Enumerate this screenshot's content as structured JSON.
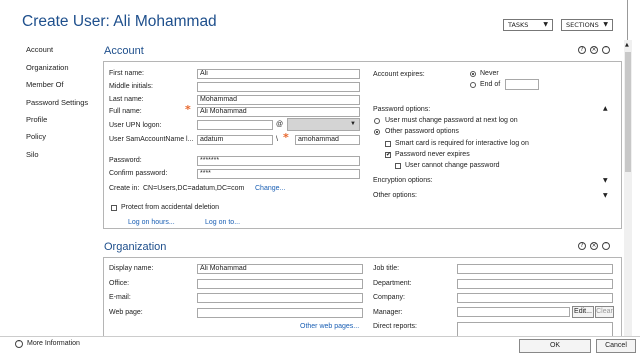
{
  "window": {
    "title": "Create User: Ali Mohammad"
  },
  "header": {
    "tasks_label": "TASKS",
    "sections_label": "SECTIONS"
  },
  "nav": {
    "items": [
      "Account",
      "Organization",
      "Member Of",
      "Password Settings",
      "Profile",
      "Policy",
      "Silo"
    ]
  },
  "account": {
    "heading": "Account",
    "first_name_label": "First name:",
    "first_name": "Ali",
    "middle_initials_label": "Middle initials:",
    "middle_initials": "",
    "last_name_label": "Last name:",
    "last_name": "Mohammad",
    "full_name_label": "Full name:",
    "full_name": "Ali Mohammad",
    "upn_label": "User UPN logon:",
    "upn": "",
    "upn_at": "@",
    "sam_label": "User SamAccountName l...",
    "sam_domain": "adatum",
    "sam_sep": "\\",
    "sam_name": "amohammad",
    "password_label": "Password:",
    "password": "*******",
    "confirm_label": "Confirm password:",
    "confirm": "****",
    "create_in_label": "Create in:",
    "create_in": "CN=Users,DC=adatum,DC=com",
    "change_link": "Change...",
    "protect_label": "Protect from accidental deletion",
    "log_on_hours": "Log on hours...",
    "log_on_to": "Log on to...",
    "expires_label": "Account expires:",
    "never_label": "Never",
    "end_of_label": "End of",
    "password_options_label": "Password options:",
    "must_change_label": "User must change password at next log on",
    "other_options_label": "Other password options",
    "smart_card_label": "Smart card is required for interactive log on",
    "never_expires_label": "Password never expires",
    "cannot_change_label": "User cannot change password",
    "encryption_label": "Encryption options:",
    "other_label": "Other options:"
  },
  "organization": {
    "heading": "Organization",
    "display_name_label": "Display name:",
    "display_name": "Ali Mohammad",
    "office_label": "Office:",
    "email_label": "E-mail:",
    "web_label": "Web page:",
    "other_web_link": "Other web pages...",
    "job_title_label": "Job title:",
    "department_label": "Department:",
    "company_label": "Company:",
    "manager_label": "Manager:",
    "edit_label": "Edit...",
    "clear_label": "Clear",
    "direct_reports_label": "Direct reports:"
  },
  "footer": {
    "more_info": "More Information",
    "ok_label": "OK",
    "cancel_label": "Cancel"
  }
}
